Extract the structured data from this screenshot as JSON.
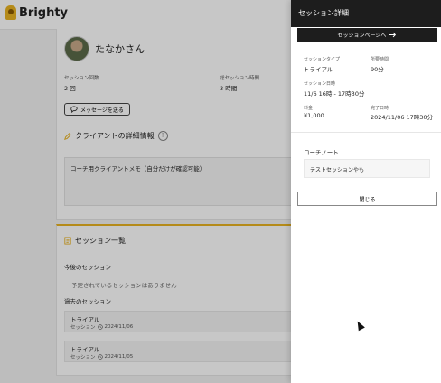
{
  "app": {
    "name": "Brighty"
  },
  "client": {
    "name": "たなかさん",
    "stats": [
      {
        "label": "セッション回数",
        "value": "2 回"
      },
      {
        "label": "総セッション時間",
        "value": "3 時間"
      }
    ],
    "message_button": "メッセージを送る",
    "details_title": "クライアントの詳細情報",
    "memo_text": "コーチ用クライアントメモ（自分だけが確認可能）"
  },
  "sessions": {
    "title": "セッション一覧",
    "upcoming_label": "今後のセッション",
    "upcoming_empty": "予定されているセッションはありません",
    "past_label": "過去のセッション",
    "items": [
      {
        "type": "トライアル",
        "meta_label": "セッション",
        "date": "2024/11/06"
      },
      {
        "type": "トライアル",
        "meta_label": "セッション",
        "date": "2024/11/05"
      }
    ]
  },
  "panel": {
    "title": "セッション詳細",
    "page_button": "セッションページへ",
    "fields": {
      "type_label": "セッションタイプ",
      "type_value": "トライアル",
      "duration_label": "所要時間",
      "duration_value": "90分",
      "datetime_label": "セッション日時",
      "datetime_value": "11/6 16時 - 17時30分",
      "fee_label": "料金",
      "fee_value": "¥1,000",
      "completed_label": "完了日時",
      "completed_value": "2024/11/06 17時30分"
    },
    "note_label": "コーチノート",
    "note_value": "テストセッションやも",
    "close_button": "閉じる"
  },
  "colors": {
    "accent": "#e8b322",
    "dark": "#1d1d1d"
  }
}
